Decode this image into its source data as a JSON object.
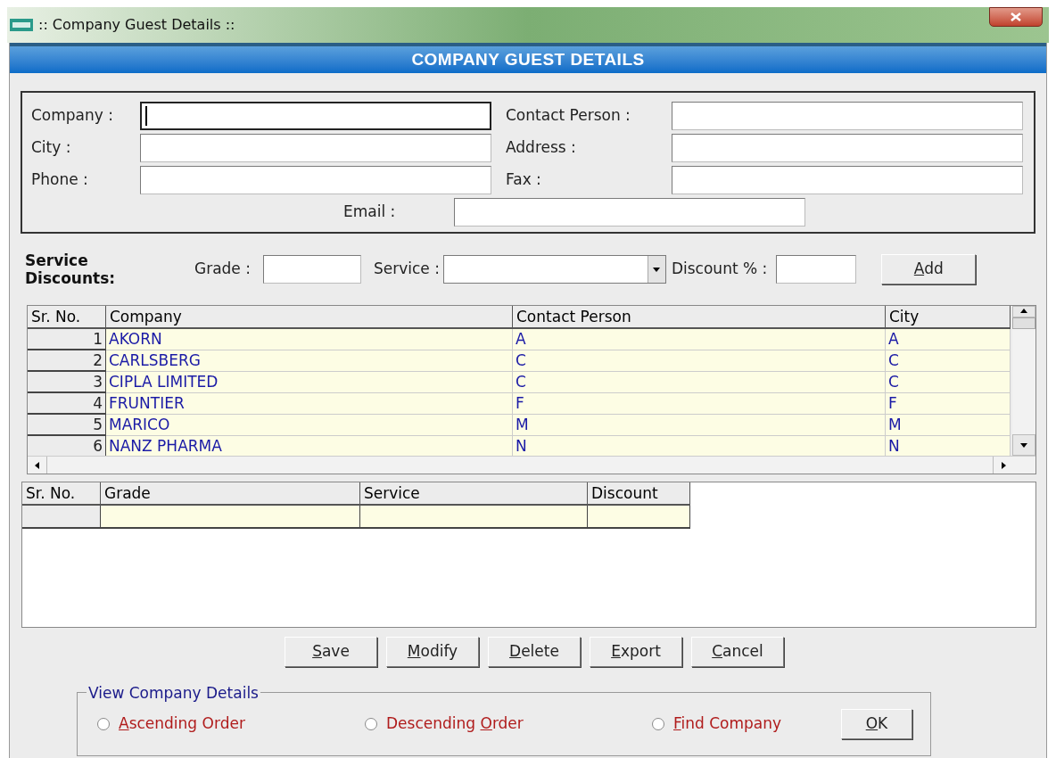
{
  "window": {
    "title": ":: Company Guest Details ::"
  },
  "header": {
    "title": "COMPANY GUEST DETAILS"
  },
  "company_form": {
    "fields": [
      {
        "label": "Company :",
        "focused": true
      },
      {
        "label": "Contact Person :",
        "focused": false
      },
      {
        "label": "City :",
        "focused": false
      },
      {
        "label": "Address :",
        "focused": false
      },
      {
        "label": "Phone :",
        "focused": false
      },
      {
        "label": "Fax :",
        "focused": false
      }
    ],
    "email": {
      "label": "Email :",
      "focused": false
    }
  },
  "service_discounts": {
    "title": "Service Discounts:",
    "grade_label": "Grade :",
    "service_label": "Service :",
    "discount_label": "Discount % :",
    "add_button": {
      "mnemonic": "A",
      "rest": "dd"
    }
  },
  "companies_table": {
    "columns": [
      "Sr. No.",
      "Company",
      "Contact Person",
      "City"
    ],
    "rows": [
      [
        "1",
        "AKORN",
        "A",
        "A"
      ],
      [
        "2",
        "CARLSBERG",
        "C",
        "C"
      ],
      [
        "3",
        "CIPLA LIMITED",
        "C",
        "C"
      ],
      [
        "4",
        "FRUNTIER",
        "F",
        "F"
      ],
      [
        "5",
        "MARICO",
        "M",
        "M"
      ],
      [
        "6",
        "NANZ PHARMA",
        "N",
        "N"
      ]
    ]
  },
  "discounts_table": {
    "columns": [
      "Sr. No.",
      "Grade",
      "Service",
      "Discount"
    ]
  },
  "buttons": [
    {
      "mnemonic": "S",
      "rest": "ave"
    },
    {
      "mnemonic": "M",
      "rest": "odify"
    },
    {
      "mnemonic": "D",
      "rest": "elete"
    },
    {
      "mnemonic": "E",
      "rest": "xport"
    },
    {
      "mnemonic": "C",
      "rest": "ancel"
    }
  ],
  "view_group": {
    "title": "View Company Details",
    "options": [
      {
        "mnemonic": "A",
        "rest": "scending Order",
        "selected": false
      },
      {
        "prefix": "Descending ",
        "mnemonic": "O",
        "rest": "rder",
        "selected": false
      },
      {
        "mnemonic": "F",
        "rest": "ind Company",
        "selected": false
      }
    ],
    "ok_button": {
      "mnemonic": "O",
      "rest": "K"
    }
  }
}
